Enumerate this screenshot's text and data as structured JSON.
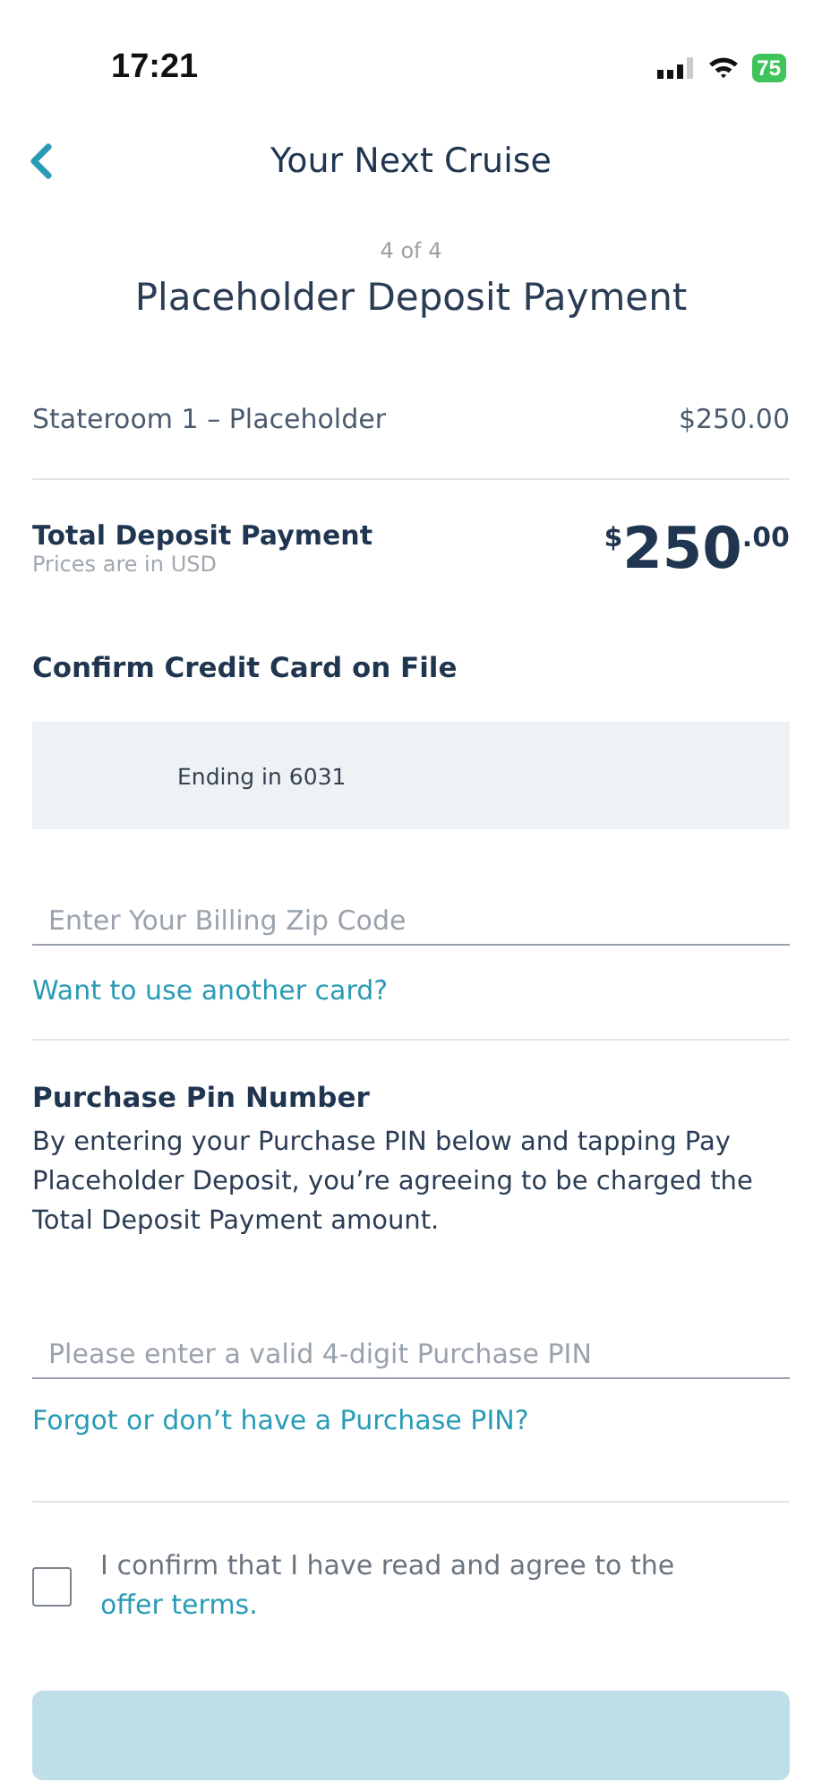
{
  "status_bar": {
    "time": "17:21",
    "battery": "75"
  },
  "header": {
    "title": "Your Next Cruise"
  },
  "step": "4 of 4",
  "page_title": "Placeholder Deposit Payment",
  "line_items": [
    {
      "label": "Stateroom 1 – Placeholder",
      "amount": "$250.00"
    }
  ],
  "total": {
    "label": "Total Deposit Payment",
    "note": "Prices are in USD",
    "currency": "$",
    "whole": "250",
    "cents": ".00"
  },
  "card": {
    "heading": "Confirm Credit Card on File",
    "ending": "Ending in 6031"
  },
  "zip_field": {
    "placeholder": "Enter Your Billing Zip Code"
  },
  "another_card_link": "Want to use another card?",
  "pin": {
    "heading": "Purchase Pin Number",
    "description": "By entering your Purchase PIN below and tapping Pay Placeholder Deposit, you’re agreeing to be charged the Total Deposit Payment amount.",
    "placeholder": "Please enter a valid 4-digit Purchase PIN",
    "link": "Forgot or don’t have a Purchase PIN?"
  },
  "consent": {
    "checked": false,
    "text": "I confirm that I have read and agree to the",
    "link": "offer terms."
  },
  "pay_button": {
    "disabled": true
  }
}
